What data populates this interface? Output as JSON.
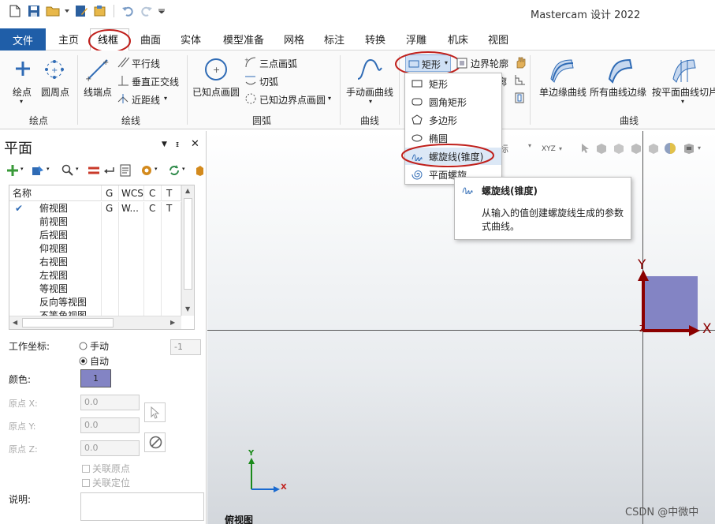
{
  "app": {
    "title": "Mastercam 设计 2022"
  },
  "tabs": [
    "文件",
    "主页",
    "线框",
    "曲面",
    "实体",
    "模型准备",
    "网格",
    "标注",
    "转换",
    "浮雕",
    "机床",
    "视图"
  ],
  "ribbon": {
    "draw_point": {
      "items": [
        "绘点",
        "圆周点"
      ],
      "label": "绘点"
    },
    "draw_line": {
      "items": [
        "线端点",
        "平行线",
        "垂直正交线",
        "近距线"
      ],
      "label": "绘线"
    },
    "arc": {
      "items": [
        "已知点画圆",
        "三点画弧",
        "切弧",
        "已知边界点画圆"
      ],
      "label": "圆弧"
    },
    "spline": {
      "items": [
        "手动画曲线"
      ],
      "label": "曲线"
    },
    "shape": {
      "rect_split": "矩形",
      "boundary": "边界轮廓",
      "partial": "廓"
    },
    "curves": {
      "items": [
        "单边缘曲线",
        "所有曲线边缘",
        "按平面曲线切片"
      ],
      "label": "曲线"
    }
  },
  "dropdown": {
    "items": [
      "矩形",
      "圆角矩形",
      "多边形",
      "椭圆",
      "螺旋线(锥度)",
      "平面螺旋"
    ],
    "highlighted": "螺旋线(锥度)"
  },
  "tooltip": {
    "title": "螺旋线(锥度)",
    "desc1": "从输入的值创建螺旋线生成的参数",
    "desc2": "式曲线。"
  },
  "toolbar_partial": {
    "cursor": "光标",
    "view": "XYZ"
  },
  "panel": {
    "title": "平面",
    "columns": [
      "名称",
      "G",
      "WCS",
      "C",
      "T"
    ],
    "rows": [
      {
        "name": "俯视图",
        "g": "G",
        "wcs": "W...",
        "c": "C",
        "t": "T",
        "checked": true
      },
      {
        "name": "前视图",
        "g": "",
        "wcs": "",
        "c": "",
        "t": "",
        "checked": false
      },
      {
        "name": "后视图",
        "g": "",
        "wcs": "",
        "c": "",
        "t": "",
        "checked": false
      },
      {
        "name": "仰视图",
        "g": "",
        "wcs": "",
        "c": "",
        "t": "",
        "checked": false
      },
      {
        "name": "右视图",
        "g": "",
        "wcs": "",
        "c": "",
        "t": "",
        "checked": false
      },
      {
        "name": "左视图",
        "g": "",
        "wcs": "",
        "c": "",
        "t": "",
        "checked": false
      },
      {
        "name": "等视图",
        "g": "",
        "wcs": "",
        "c": "",
        "t": "",
        "checked": false
      },
      {
        "name": "反向等视图",
        "g": "",
        "wcs": "",
        "c": "",
        "t": "",
        "checked": false
      },
      {
        "name": "不等角视图",
        "g": "",
        "wcs": "",
        "c": "",
        "t": "",
        "checked": false
      }
    ],
    "work_coord_label": "工作坐标:",
    "manual_label": "手动",
    "auto_label": "自动",
    "manual_value": "-1",
    "color_label": "颜色:",
    "color_value": "1",
    "origin_x_label": "原点 X:",
    "origin_y_label": "原点 Y:",
    "origin_z_label": "原点 Z:",
    "origin_x": "0.0",
    "origin_y": "0.0",
    "origin_z": "0.0",
    "assoc_origin": "关联原点",
    "assoc_position": "关联定位",
    "desc_label": "说明:"
  },
  "viewport": {
    "axis_x": "X",
    "axis_y": "Y",
    "mini_x": "X",
    "mini_y": "Y",
    "view_name": "俯视图",
    "watermark": "CSDN @中微中"
  },
  "colors": {
    "accent": "#1f5ea8",
    "highlight_circle": "#c0201c",
    "plane_fill": "#8384c4",
    "axis": "#8b0000"
  }
}
